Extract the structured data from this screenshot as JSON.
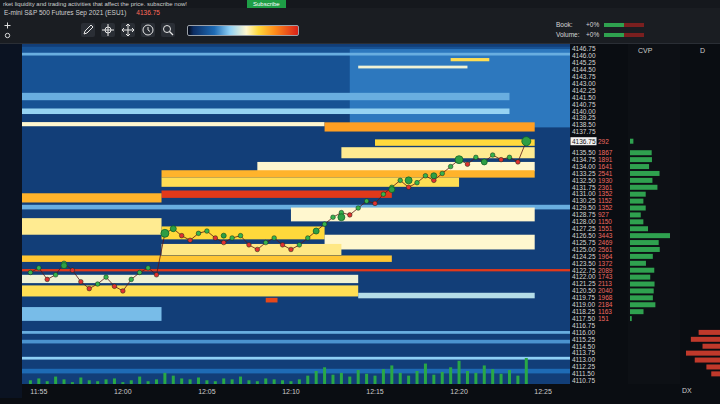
{
  "banner": {
    "text": "rket liquidity and trading activities that affect the price. subscribe now!",
    "button": "Subscribe"
  },
  "instrument": {
    "name": "E-mini S&P 500 Futures Sep 2021 (ESU1)",
    "price": "4136.75"
  },
  "meters": [
    {
      "label": "Book:",
      "reading": "+0%",
      "level": 0.5
    },
    {
      "label": "Volume:",
      "reading": "+0%",
      "level": 0.5
    }
  ],
  "panels": {
    "cvp": "CVP",
    "dx": "D",
    "dx_footer": "DX"
  },
  "axis": {
    "labels": [
      {
        "price": "4146.75",
        "current": false
      },
      {
        "price": "4146.00",
        "current": false
      },
      {
        "price": "4145.25",
        "current": false
      },
      {
        "price": "4144.50",
        "current": false
      },
      {
        "price": "4143.75",
        "current": false
      },
      {
        "price": "4143.00",
        "current": false
      },
      {
        "price": "4142.25",
        "current": false
      },
      {
        "price": "4141.50",
        "current": false
      },
      {
        "price": "4140.75",
        "current": false
      },
      {
        "price": "4140.00",
        "current": false
      },
      {
        "price": "4139.25",
        "current": false
      },
      {
        "price": "4138.50",
        "current": false
      },
      {
        "price": "4137.75",
        "current": false
      },
      {
        "price": "4136.75",
        "volume": "292",
        "current": true
      },
      {
        "price": "4135.50",
        "volume": "1867",
        "current": false
      },
      {
        "price": "4134.75",
        "volume": "1891",
        "current": false
      },
      {
        "price": "4134.00",
        "volume": "1641",
        "current": false
      },
      {
        "price": "4133.25",
        "volume": "2541",
        "current": false
      },
      {
        "price": "4132.50",
        "volume": "1930",
        "current": false
      },
      {
        "price": "4131.75",
        "volume": "2361",
        "current": false
      },
      {
        "price": "4131.00",
        "volume": "1352",
        "current": false
      },
      {
        "price": "4130.25",
        "volume": "1152",
        "current": false
      },
      {
        "price": "4129.50",
        "volume": "1352",
        "current": false
      },
      {
        "price": "4128.75",
        "volume": "927",
        "current": false
      },
      {
        "price": "4128.00",
        "volume": "1150",
        "current": false
      },
      {
        "price": "4127.25",
        "volume": "1551",
        "current": false
      },
      {
        "price": "4126.50",
        "volume": "3443",
        "current": false
      },
      {
        "price": "4125.75",
        "volume": "2469",
        "current": false
      },
      {
        "price": "4125.00",
        "volume": "2561",
        "current": false
      },
      {
        "price": "4124.25",
        "volume": "1964",
        "current": false
      },
      {
        "price": "4123.50",
        "volume": "1372",
        "current": false
      },
      {
        "price": "4122.75",
        "volume": "2089",
        "current": false
      },
      {
        "price": "4122.00",
        "volume": "1743",
        "current": false
      },
      {
        "price": "4121.25",
        "volume": "2113",
        "current": false
      },
      {
        "price": "4120.50",
        "volume": "2040",
        "current": false
      },
      {
        "price": "4119.75",
        "volume": "1968",
        "current": false
      },
      {
        "price": "4119.00",
        "volume": "2184",
        "current": false
      },
      {
        "price": "4118.25",
        "volume": "1163",
        "current": false
      },
      {
        "price": "4117.50",
        "volume": "151",
        "current": false
      },
      {
        "price": "4116.75",
        "current": false
      },
      {
        "price": "4116.00",
        "current": false
      },
      {
        "price": "4115.25",
        "current": false
      },
      {
        "price": "4114.50",
        "current": false
      },
      {
        "price": "4113.75",
        "current": false
      },
      {
        "price": "4113.00",
        "current": false
      },
      {
        "price": "4112.25",
        "current": false
      },
      {
        "price": "4111.50",
        "current": false
      },
      {
        "price": "4110.75",
        "current": false
      }
    ]
  },
  "time": {
    "labels": [
      "11:55",
      "12:00",
      "12:05",
      "12:10",
      "12:15",
      "12:20",
      "12:25"
    ]
  },
  "heatmap": {
    "bands": [
      {
        "price": 4143.5,
        "from": 0,
        "to": 32.6,
        "span": 7.0,
        "level": 0.12
      },
      {
        "price": 4142.5,
        "from": 19.5,
        "to": 32.6,
        "span": 8.5,
        "level": 0.22
      },
      {
        "price": 4146.2,
        "from": 0,
        "to": 32.6,
        "span": 0.3,
        "level": 0.3
      },
      {
        "price": 4145.6,
        "from": 25.5,
        "to": 27.8,
        "span": 0.35,
        "level": 0.6
      },
      {
        "price": 4144.8,
        "from": 20.0,
        "to": 26.5,
        "span": 0.3,
        "level": 0.48
      },
      {
        "price": 4141.6,
        "from": 0,
        "to": 29.0,
        "span": 0.8,
        "level": 0.3
      },
      {
        "price": 4140.0,
        "from": 0,
        "to": 29.0,
        "span": 0.6,
        "level": 0.36
      },
      {
        "price": 4138.6,
        "from": 0,
        "to": 18.0,
        "span": 0.45,
        "level": 0.5
      },
      {
        "price": 4138.3,
        "from": 18.0,
        "to": 30.5,
        "span": 1.0,
        "level": 0.74
      },
      {
        "price": 4136.6,
        "from": 21.0,
        "to": 30.5,
        "span": 0.7,
        "level": 0.62
      },
      {
        "price": 4135.5,
        "from": 19.0,
        "to": 30.5,
        "span": 1.2,
        "level": 0.55
      },
      {
        "price": 4134.0,
        "from": 14.0,
        "to": 30.5,
        "span": 1.0,
        "level": 0.5
      },
      {
        "price": 4133.2,
        "from": 8.3,
        "to": 30.5,
        "span": 0.8,
        "level": 0.7
      },
      {
        "price": 4132.3,
        "from": 8.3,
        "to": 26.0,
        "span": 1.0,
        "level": 0.6
      },
      {
        "price": 4131.0,
        "from": 8.3,
        "to": 22.0,
        "span": 0.8,
        "level": 0.95
      },
      {
        "price": 4130.6,
        "from": 0,
        "to": 8.3,
        "span": 1.0,
        "level": 0.7
      },
      {
        "price": 4129.6,
        "from": 0,
        "to": 32.6,
        "span": 0.5,
        "level": 0.3
      },
      {
        "price": 4128.8,
        "from": 16.0,
        "to": 30.5,
        "span": 1.5,
        "level": 0.5
      },
      {
        "price": 4127.5,
        "from": 0,
        "to": 8.3,
        "span": 1.8,
        "level": 0.55
      },
      {
        "price": 4126.8,
        "from": 8.3,
        "to": 18.0,
        "span": 1.4,
        "level": 0.62
      },
      {
        "price": 4125.8,
        "from": 18.0,
        "to": 30.5,
        "span": 1.6,
        "level": 0.5
      },
      {
        "price": 4125.0,
        "from": 8.3,
        "to": 19.0,
        "span": 1.2,
        "level": 0.56
      },
      {
        "price": 4124.0,
        "from": 0,
        "to": 22.0,
        "span": 0.7,
        "level": 0.66
      },
      {
        "price": 4122.75,
        "from": 0,
        "to": 32.6,
        "span": 0.25,
        "level": 0.95
      },
      {
        "price": 4121.8,
        "from": 0,
        "to": 20.0,
        "span": 0.9,
        "level": 0.48
      },
      {
        "price": 4120.5,
        "from": 0,
        "to": 20.0,
        "span": 1.2,
        "level": 0.6
      },
      {
        "price": 4120.0,
        "from": 20.0,
        "to": 30.5,
        "span": 0.6,
        "level": 0.4
      },
      {
        "price": 4119.5,
        "from": 14.5,
        "to": 15.2,
        "span": 0.5,
        "level": 0.92
      },
      {
        "price": 4118.0,
        "from": 0,
        "to": 8.3,
        "span": 1.5,
        "level": 0.32
      },
      {
        "price": 4116.0,
        "from": 0,
        "to": 32.6,
        "span": 0.3,
        "level": 0.3
      },
      {
        "price": 4115.0,
        "from": 0,
        "to": 32.6,
        "span": 0.4,
        "level": 0.26
      },
      {
        "price": 4113.2,
        "from": 0,
        "to": 32.6,
        "span": 0.3,
        "level": 0.35
      },
      {
        "price": 4111.8,
        "from": 0,
        "to": 32.6,
        "span": 0.5,
        "level": 0.2
      }
    ]
  },
  "trades": {
    "start": 0.5,
    "step": 0.5,
    "prices": [
      4122.5,
      4123.0,
      4121.75,
      4122.25,
      4123.5,
      4122.75,
      4121.5,
      4120.75,
      4121.25,
      4122.0,
      4121.0,
      4120.5,
      4121.75,
      4122.5,
      4123.0,
      4122.25,
      4126.75,
      4127.25,
      4126.5,
      4126.0,
      4126.75,
      4127.0,
      4126.25,
      4125.75,
      4126.25,
      4126.5,
      4125.5,
      4125.0,
      4125.75,
      4126.25,
      4125.5,
      4125.0,
      4125.5,
      4126.25,
      4127.0,
      4127.75,
      4128.5,
      4129.0,
      4128.75,
      4129.5,
      4130.25,
      4130.0,
      4131.0,
      4131.75,
      4132.5,
      4131.75,
      4132.25,
      4133.0,
      4132.5,
      4133.25,
      4134.0,
      4134.75,
      4134.25,
      4135.0,
      4134.5,
      4135.25,
      4134.75,
      4135.0,
      4134.5,
      4136.75
    ]
  },
  "bubbles": [
    {
      "time": 2.5,
      "price": 4123.25,
      "size": 3
    },
    {
      "time": 8.5,
      "price": 4126.75,
      "size": 4
    },
    {
      "time": 9.0,
      "price": 4127.25,
      "size": 3
    },
    {
      "time": 12.0,
      "price": 4126.5,
      "size": 2.5
    },
    {
      "time": 17.5,
      "price": 4127.0,
      "size": 3
    },
    {
      "time": 19.0,
      "price": 4128.5,
      "size": 3.5
    },
    {
      "time": 22.0,
      "price": 4131.5,
      "size": 3
    },
    {
      "time": 23.0,
      "price": 4132.5,
      "size": 3.5
    },
    {
      "time": 24.5,
      "price": 4133.0,
      "size": 3
    },
    {
      "time": 26.0,
      "price": 4134.75,
      "size": 4
    },
    {
      "time": 27.5,
      "price": 4134.5,
      "size": 3
    },
    {
      "time": 30.0,
      "price": 4136.75,
      "size": 4.5
    }
  ],
  "volume": {
    "start": 0.5,
    "step": 0.5,
    "values": [
      4,
      6,
      3,
      8,
      5,
      2,
      7,
      4,
      3,
      5,
      6,
      2,
      4,
      8,
      3,
      5,
      12,
      9,
      6,
      5,
      7,
      4,
      3,
      6,
      5,
      8,
      4,
      3,
      6,
      5,
      4,
      3,
      5,
      9,
      14,
      18,
      10,
      12,
      8,
      15,
      11,
      9,
      16,
      20,
      12,
      9,
      14,
      22,
      10,
      13,
      18,
      25,
      14,
      12,
      20,
      16,
      11,
      15,
      9,
      28
    ]
  },
  "delta": [
    {
      "price": 4116.0,
      "value": 22
    },
    {
      "price": 4115.25,
      "value": 30
    },
    {
      "price": 4114.5,
      "value": 18
    },
    {
      "price": 4113.75,
      "value": 35
    },
    {
      "price": 4113.0,
      "value": 26
    },
    {
      "price": 4112.25,
      "value": 14
    },
    {
      "price": 4111.5,
      "value": 9
    }
  ]
}
